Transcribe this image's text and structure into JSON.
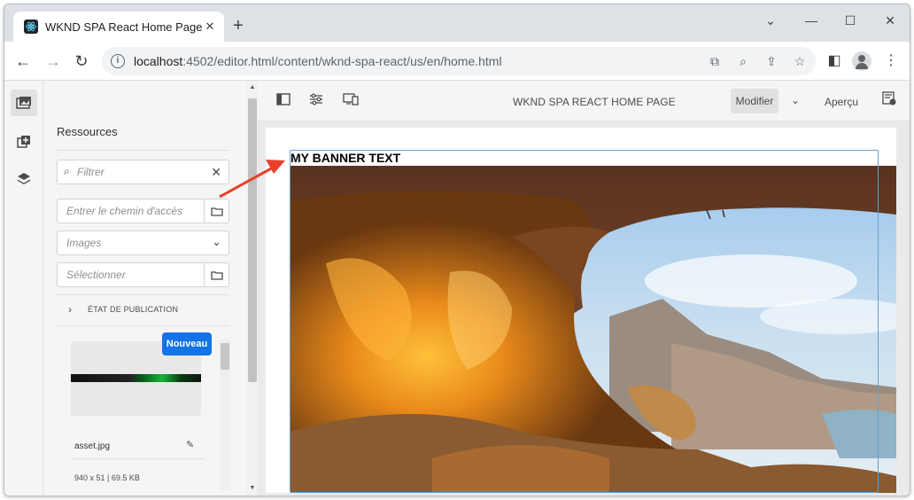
{
  "browser": {
    "tab_title": "WKND SPA React Home Page",
    "url_host": "localhost",
    "url_rest": ":4502/editor.html/content/wknd-spa-react/us/en/home.html"
  },
  "editor": {
    "page_title": "WKND SPA REACT HOME PAGE",
    "mode_label": "Modifier",
    "preview_label": "Aperçu"
  },
  "panel": {
    "title": "Ressources",
    "filter_placeholder": "Filtrer",
    "path_placeholder": "Entrer le chemin d'accès",
    "type_select": "Images",
    "tag_placeholder": "Sélectionner",
    "publish_state": "ÉTAT DE PUBLICATION",
    "new_badge": "Nouveau",
    "asset_name": "asset.jpg",
    "asset_meta": "940 x 51 | 69.5 KB"
  },
  "page": {
    "banner_text": "MY BANNER TEXT"
  },
  "colors": {
    "accent": "#1473e6",
    "annotation_arrow": "#e8402a"
  }
}
